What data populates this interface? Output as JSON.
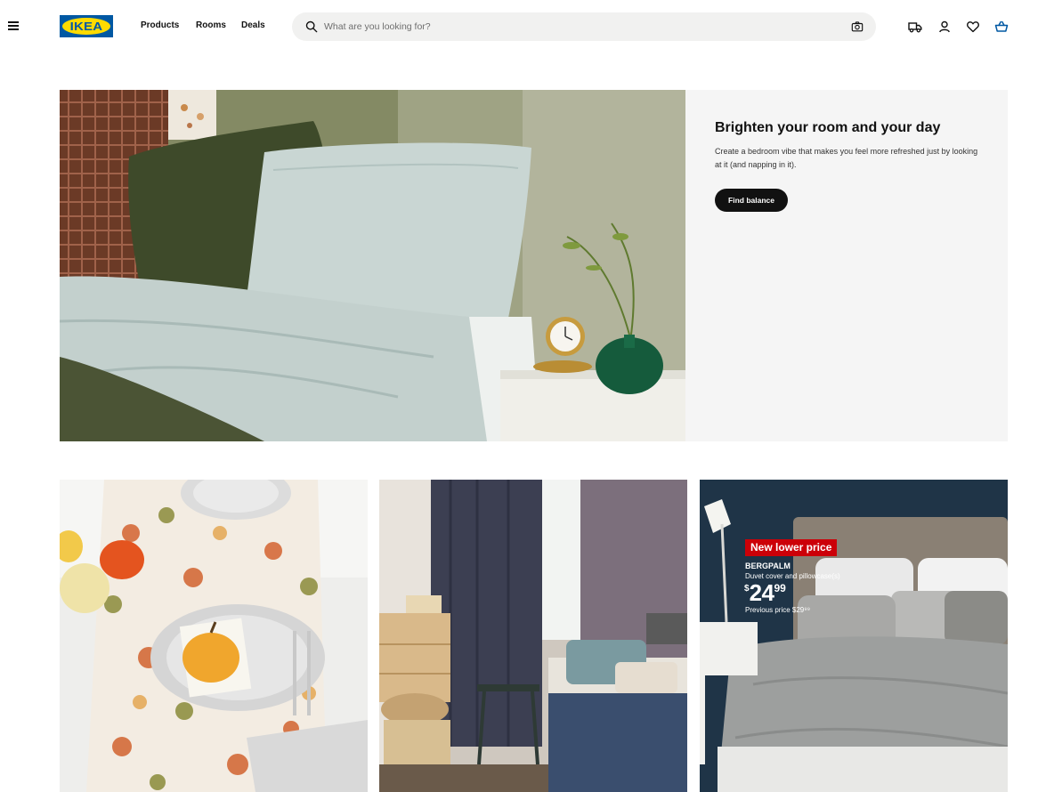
{
  "header": {
    "menu_icon": "hamburger-menu-icon",
    "logo_text": "IKEA",
    "nav": [
      "Products",
      "Rooms",
      "Deals"
    ],
    "search": {
      "placeholder": "What are you looking for?",
      "value": ""
    },
    "icons": [
      "delivery-truck-icon",
      "user-icon",
      "heart-icon",
      "shopping-bag-icon"
    ]
  },
  "hero": {
    "title": "Brighten your room and your day",
    "description": "Create a bedroom vibe that makes you feel more refreshed just by looking at it (and napping in it).",
    "button_label": "Find balance"
  },
  "cards": [
    {
      "subject": "autumn-table-setting"
    },
    {
      "subject": "bedroom-with-curtains"
    },
    {
      "subject": "bergpalm-duvet-promo",
      "badge": "New lower price",
      "product_name": "BERGPALM",
      "product_desc": "Duvet cover and pillowcase(s)",
      "price_currency": "$",
      "price_main": "24",
      "price_cents": "99",
      "previous_price": "Previous price $29⁹⁹"
    }
  ],
  "colors": {
    "ikea_blue": "#0058a3",
    "ikea_yellow": "#ffdb00",
    "hero_panel_bg": "#f5f5f5",
    "promo_red": "#cc0008",
    "button_black": "#111111"
  }
}
